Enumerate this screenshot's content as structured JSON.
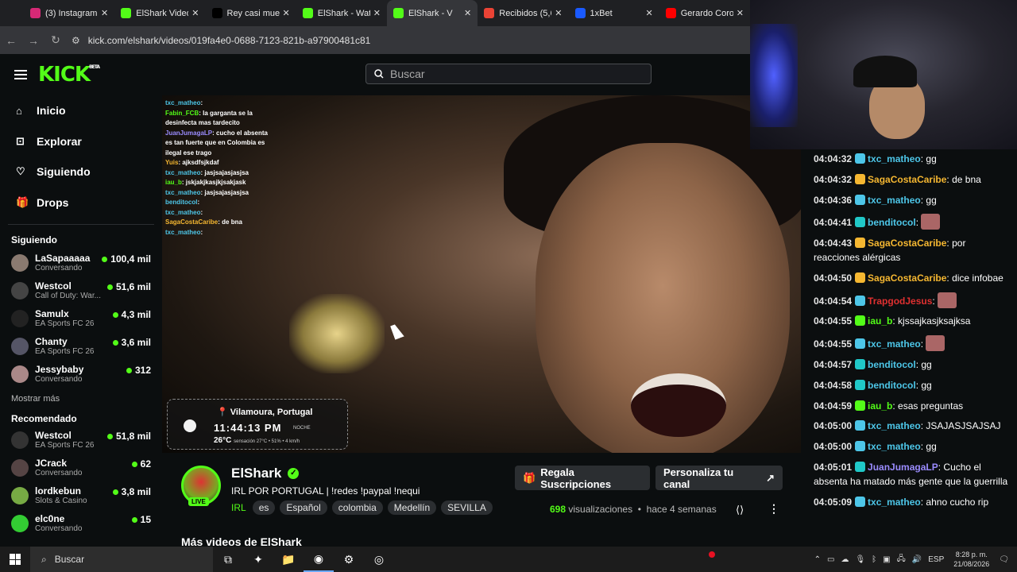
{
  "browser": {
    "tabs": [
      {
        "label": "(3) Instagram",
        "color": "#d62976"
      },
      {
        "label": "ElShark Video",
        "color": "#53fc18"
      },
      {
        "label": "Rey casi muer",
        "color": "#000000"
      },
      {
        "label": "ElShark - Wat",
        "color": "#53fc18"
      },
      {
        "label": "ElShark - V",
        "color": "#53fc18",
        "active": true
      },
      {
        "label": "Recibidos (5,6",
        "color": "#ea4335"
      },
      {
        "label": "1xBet",
        "color": "#1a5aff"
      },
      {
        "label": "Gerardo Coro",
        "color": "#ff0000"
      }
    ],
    "url": "kick.com/elshark/videos/019fa4e0-0688-7123-821b-a97900481c81"
  },
  "header": {
    "logo": "KICK",
    "logo_badge": "BETA",
    "search_placeholder": "Buscar"
  },
  "sidebar": {
    "nav": [
      {
        "label": "Inicio",
        "icon": "home-icon"
      },
      {
        "label": "Explorar",
        "icon": "compass-icon"
      },
      {
        "label": "Siguiendo",
        "icon": "heart-icon"
      },
      {
        "label": "Drops",
        "icon": "gift-icon"
      }
    ],
    "following_title": "Siguiendo",
    "following": [
      {
        "name": "LaSapaaaaa",
        "category": "Conversando",
        "viewers": "100,4 mil"
      },
      {
        "name": "Westcol",
        "category": "Call of Duty: War...",
        "viewers": "51,6 mil"
      },
      {
        "name": "Samulx",
        "category": "EA Sports FC 26",
        "viewers": "4,3 mil"
      },
      {
        "name": "Chanty",
        "category": "EA Sports FC 26",
        "viewers": "3,6 mil"
      },
      {
        "name": "Jessybaby",
        "category": "Conversando",
        "viewers": "312"
      }
    ],
    "show_more": "Mostrar más",
    "recommended_title": "Recomendado",
    "recommended": [
      {
        "name": "Westcol",
        "category": "EA Sports FC 26",
        "viewers": "51,8 mil"
      },
      {
        "name": "JCrack",
        "category": "Conversando",
        "viewers": "62"
      },
      {
        "name": "lordkebun",
        "category": "Slots & Casino",
        "viewers": "3,8 mil"
      },
      {
        "name": "elc0ne",
        "category": "Conversando",
        "viewers": "15"
      }
    ]
  },
  "video": {
    "overlay_chat": [
      {
        "user": "txc_matheo",
        "text": ":",
        "c": "u"
      },
      {
        "user": "Fabin_FCB",
        "text": ": la garganta se la desinfecta mas tardecito",
        "c": "g"
      },
      {
        "user": "JuanJumagaLP",
        "text": ": cucho el absenta es tan fuerte que en Colombia es ilegal ese trago",
        "c": "p"
      },
      {
        "user": "Yuis",
        "text": ": ajksdfsjkdaf",
        "c": "o"
      },
      {
        "user": "txc_matheo",
        "text": ": jasjsajasjasjsa",
        "c": "u"
      },
      {
        "user": "iau_b",
        "text": ": jskjakjkasjkjsakjask",
        "c": "g"
      },
      {
        "user": "txc_matheo",
        "text": ": jasjsajasjasjsa",
        "c": "u"
      },
      {
        "user": "benditocol",
        "text": ":",
        "c": "u"
      },
      {
        "user": "txc_matheo",
        "text": ":",
        "c": "u"
      },
      {
        "user": "SagaCostaCaribe",
        "text": ": de bna",
        "c": "o"
      },
      {
        "user": "txc_matheo",
        "text": ":",
        "c": "u"
      }
    ],
    "location": "Vilamoura, Portugal",
    "time": "11:44:13 PM",
    "ampm": "NOCHE",
    "temp": "26°C",
    "weather_detail": "sensación 27°C • 51% • 4 km/h"
  },
  "stream": {
    "live": "LIVE",
    "name": "ElShark",
    "title": "IRL POR PORTUGAL | !redes !paypal !nequi",
    "category": "IRL",
    "tags": [
      "es",
      "Español",
      "colombia",
      "Medellín",
      "SEVILLA"
    ],
    "gift_button": "Regala Suscripciones",
    "custom_button": "Personaliza tu canal",
    "views": "698",
    "views_label": "visualizaciones",
    "age": "hace 4 semanas",
    "more_videos": "Más videos de ElShark"
  },
  "chat": [
    {
      "ts": "04:04:32",
      "user": "txc_matheo",
      "color": "#4dc6e8",
      "badge": "#4dc6e8",
      "text": ": gg"
    },
    {
      "ts": "04:04:32",
      "user": "SagaCostaCaribe",
      "color": "#f5b731",
      "badge": "#f5b731",
      "text": ": de bna"
    },
    {
      "ts": "04:04:36",
      "user": "txc_matheo",
      "color": "#4dc6e8",
      "badge": "#4dc6e8",
      "text": ": gg"
    },
    {
      "ts": "04:04:41",
      "user": "benditocol",
      "color": "#4dc6e8",
      "badge": "#20c8c8",
      "text": ":",
      "emote": true
    },
    {
      "ts": "04:04:43",
      "user": "SagaCostaCaribe",
      "color": "#f5b731",
      "badge": "#f5b731",
      "text": ": por reacciones alérgicas"
    },
    {
      "ts": "04:04:50",
      "user": "SagaCostaCaribe",
      "color": "#f5b731",
      "badge": "#f5b731",
      "text": ": dice infobae"
    },
    {
      "ts": "04:04:54",
      "user": "TrapgodJesus",
      "color": "#e03030",
      "badge": "#4dc6e8",
      "text": ":",
      "emote": true
    },
    {
      "ts": "04:04:55",
      "user": "iau_b",
      "color": "#53fc18",
      "badge": "#53fc18",
      "text": ": kjssajkasjksajksa"
    },
    {
      "ts": "04:04:55",
      "user": "txc_matheo",
      "color": "#4dc6e8",
      "badge": "#4dc6e8",
      "text": ":",
      "emote": true
    },
    {
      "ts": "04:04:57",
      "user": "benditocol",
      "color": "#4dc6e8",
      "badge": "#20c8c8",
      "text": ": gg"
    },
    {
      "ts": "04:04:58",
      "user": "benditocol",
      "color": "#4dc6e8",
      "badge": "#20c8c8",
      "text": ": gg"
    },
    {
      "ts": "04:04:59",
      "user": "iau_b",
      "color": "#53fc18",
      "badge": "#53fc18",
      "text": ": esas preguntas"
    },
    {
      "ts": "04:05:00",
      "user": "txc_matheo",
      "color": "#4dc6e8",
      "badge": "#4dc6e8",
      "text": ": JSAJASJSAJSAJ"
    },
    {
      "ts": "04:05:00",
      "user": "txc_matheo",
      "color": "#4dc6e8",
      "badge": "#4dc6e8",
      "text": ": gg"
    },
    {
      "ts": "04:05:01",
      "user": "JuanJumagaLP",
      "color": "#9b8cff",
      "badge": "#20c8c8",
      "text": ": Cucho el absenta ha matado más gente que la guerrilla"
    },
    {
      "ts": "04:05:09",
      "user": "txc_matheo",
      "color": "#4dc6e8",
      "badge": "#4dc6e8",
      "text": ": ahno cucho rip"
    }
  ],
  "taskbar": {
    "search": "Buscar",
    "lang": "ESP",
    "time": "8:28 p. m.",
    "date": "21/08/2026"
  }
}
